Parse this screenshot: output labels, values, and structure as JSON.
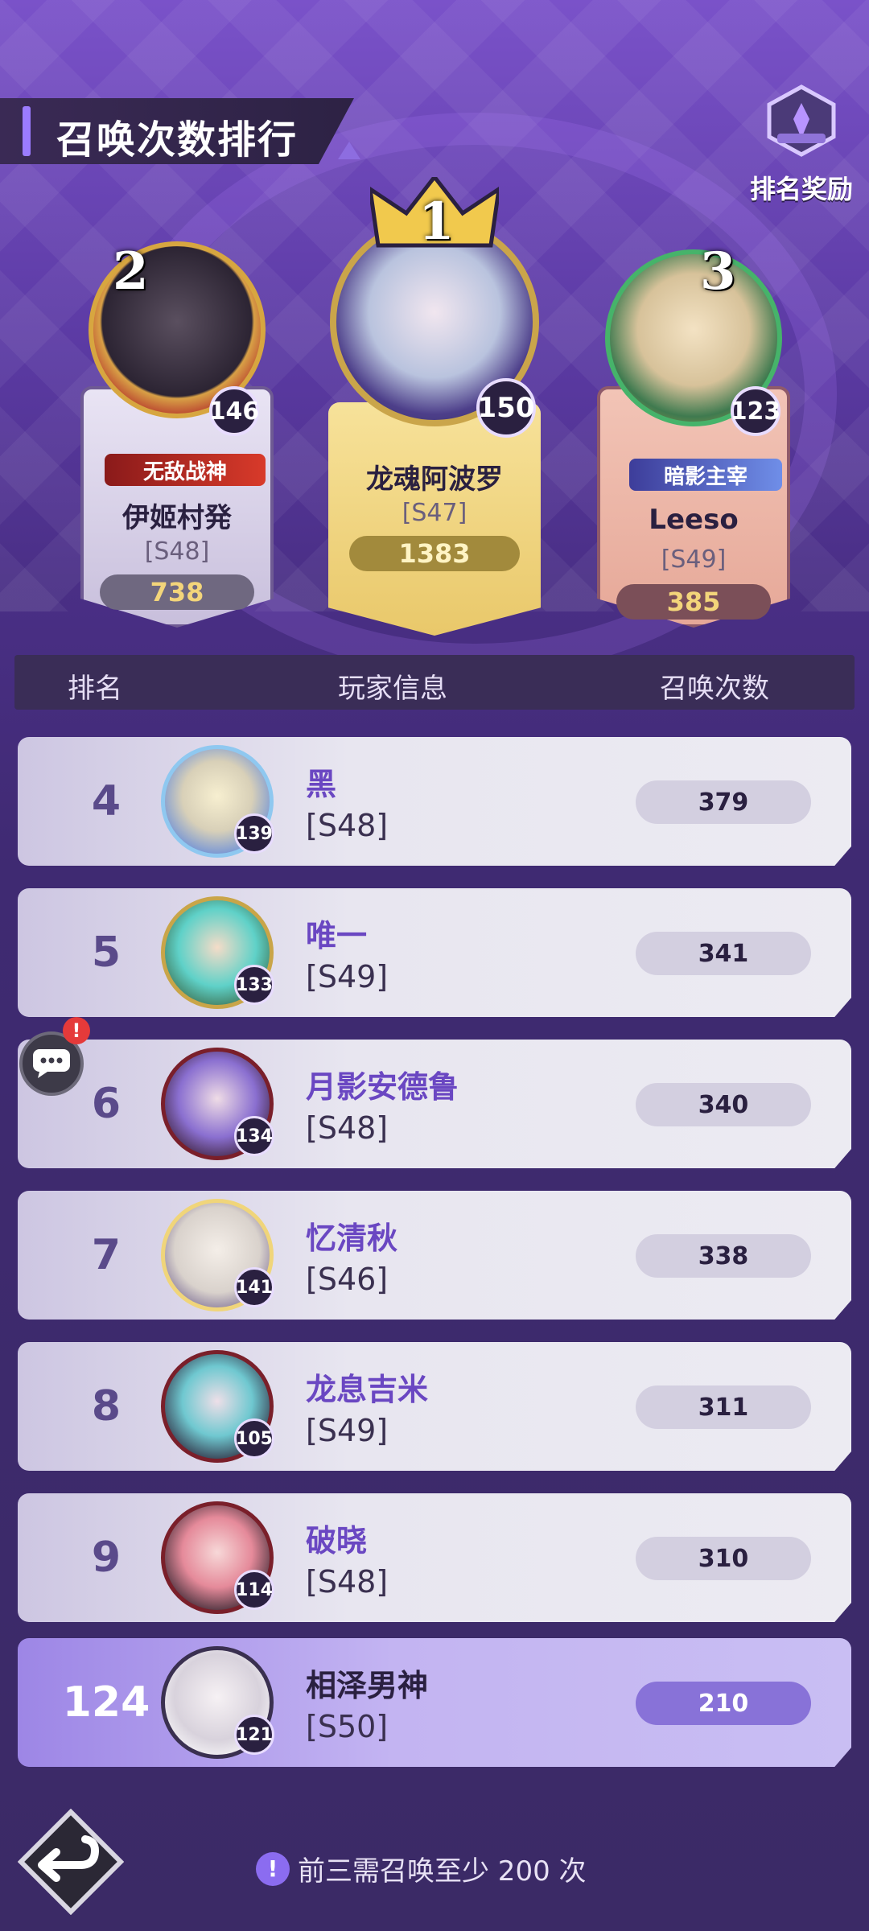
{
  "header": {
    "title": "召唤次数排行",
    "reward_label": "排名奖励"
  },
  "podium": [
    {
      "rank": "2",
      "level": "146",
      "title_badge": "无敌战神",
      "name": "伊姬村発",
      "server": "[S48]",
      "count": "738"
    },
    {
      "rank": "1",
      "level": "150",
      "name": "龙魂阿波罗",
      "server": "[S47]",
      "count": "1383"
    },
    {
      "rank": "3",
      "level": "123",
      "title_badge": "暗影主宰",
      "name": "Leeso",
      "server": "[S49]",
      "count": "385"
    }
  ],
  "table_header": {
    "rank": "排名",
    "player": "玩家信息",
    "count": "召唤次数"
  },
  "rows": [
    {
      "rank": "4",
      "level": "139",
      "name": "黑",
      "server": "[S48]",
      "count": "379"
    },
    {
      "rank": "5",
      "level": "133",
      "name": "唯一",
      "server": "[S49]",
      "count": "341"
    },
    {
      "rank": "6",
      "level": "134",
      "name": "月影安德鲁",
      "server": "[S48]",
      "count": "340"
    },
    {
      "rank": "7",
      "level": "141",
      "name": "忆清秋",
      "server": "[S46]",
      "count": "338"
    },
    {
      "rank": "8",
      "level": "105",
      "name": "龙息吉米",
      "server": "[S49]",
      "count": "311"
    },
    {
      "rank": "9",
      "level": "114",
      "name": "破晓",
      "server": "[S48]",
      "count": "310"
    }
  ],
  "self_row": {
    "rank": "124",
    "level": "121",
    "name": "相泽男神",
    "server": "[S50]",
    "count": "210"
  },
  "chat": {
    "alert": "!"
  },
  "footer": {
    "note": "前三需召唤至少 200 次",
    "icon_glyph": "!"
  }
}
